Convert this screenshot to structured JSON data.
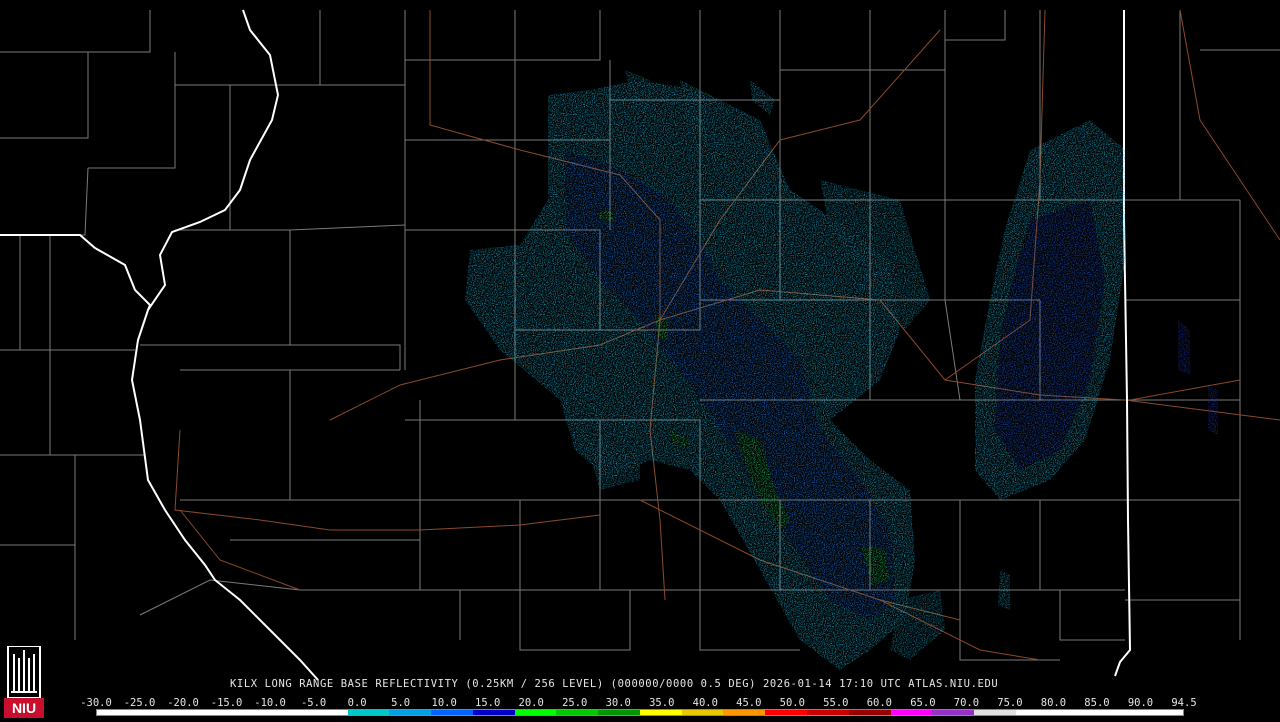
{
  "product_title": "KILX LONG RANGE BASE REFLECTIVITY (0.25KM / 256 LEVEL) (000000/0000 0.5 DEG) 2026-01-14 17:10 UTC  ATLAS.NIU.EDU",
  "logo": {
    "text": "NIU",
    "brand_color": "#c8102e"
  },
  "scale": {
    "labels": [
      "-30.0",
      "-25.0",
      "-20.0",
      "-15.0",
      "-10.0",
      "-5.0",
      "0.0",
      "5.0",
      "10.0",
      "15.0",
      "20.0",
      "25.0",
      "30.0",
      "35.0",
      "40.0",
      "45.0",
      "50.0",
      "55.0",
      "60.0",
      "65.0",
      "70.0",
      "75.0",
      "80.0",
      "85.0",
      "90.0",
      "94.5"
    ],
    "colors": [
      "#ffffff",
      "#ffffff",
      "#ffffff",
      "#ffffff",
      "#ffffff",
      "#ffffff",
      "#00c8c8",
      "#00a0e6",
      "#0064ff",
      "#0000c8",
      "#00ff00",
      "#00c800",
      "#009600",
      "#ffff00",
      "#e6c800",
      "#ff9600",
      "#ff0000",
      "#c80000",
      "#960000",
      "#ff00ff",
      "#9632c8",
      "#e1e1e1",
      "#ffffff",
      "#ffffff",
      "#ffffff",
      "#ffffff"
    ]
  },
  "colors": {
    "background": "#000000",
    "county_lines": "#7a7a7a",
    "state_lines": "#ffffff",
    "roads": "#8c4a2a",
    "echo_light": "#20c0e8",
    "echo_mid": "#1f6fe6",
    "echo_dark": "#2238c8",
    "echo_green": "#22d060"
  }
}
